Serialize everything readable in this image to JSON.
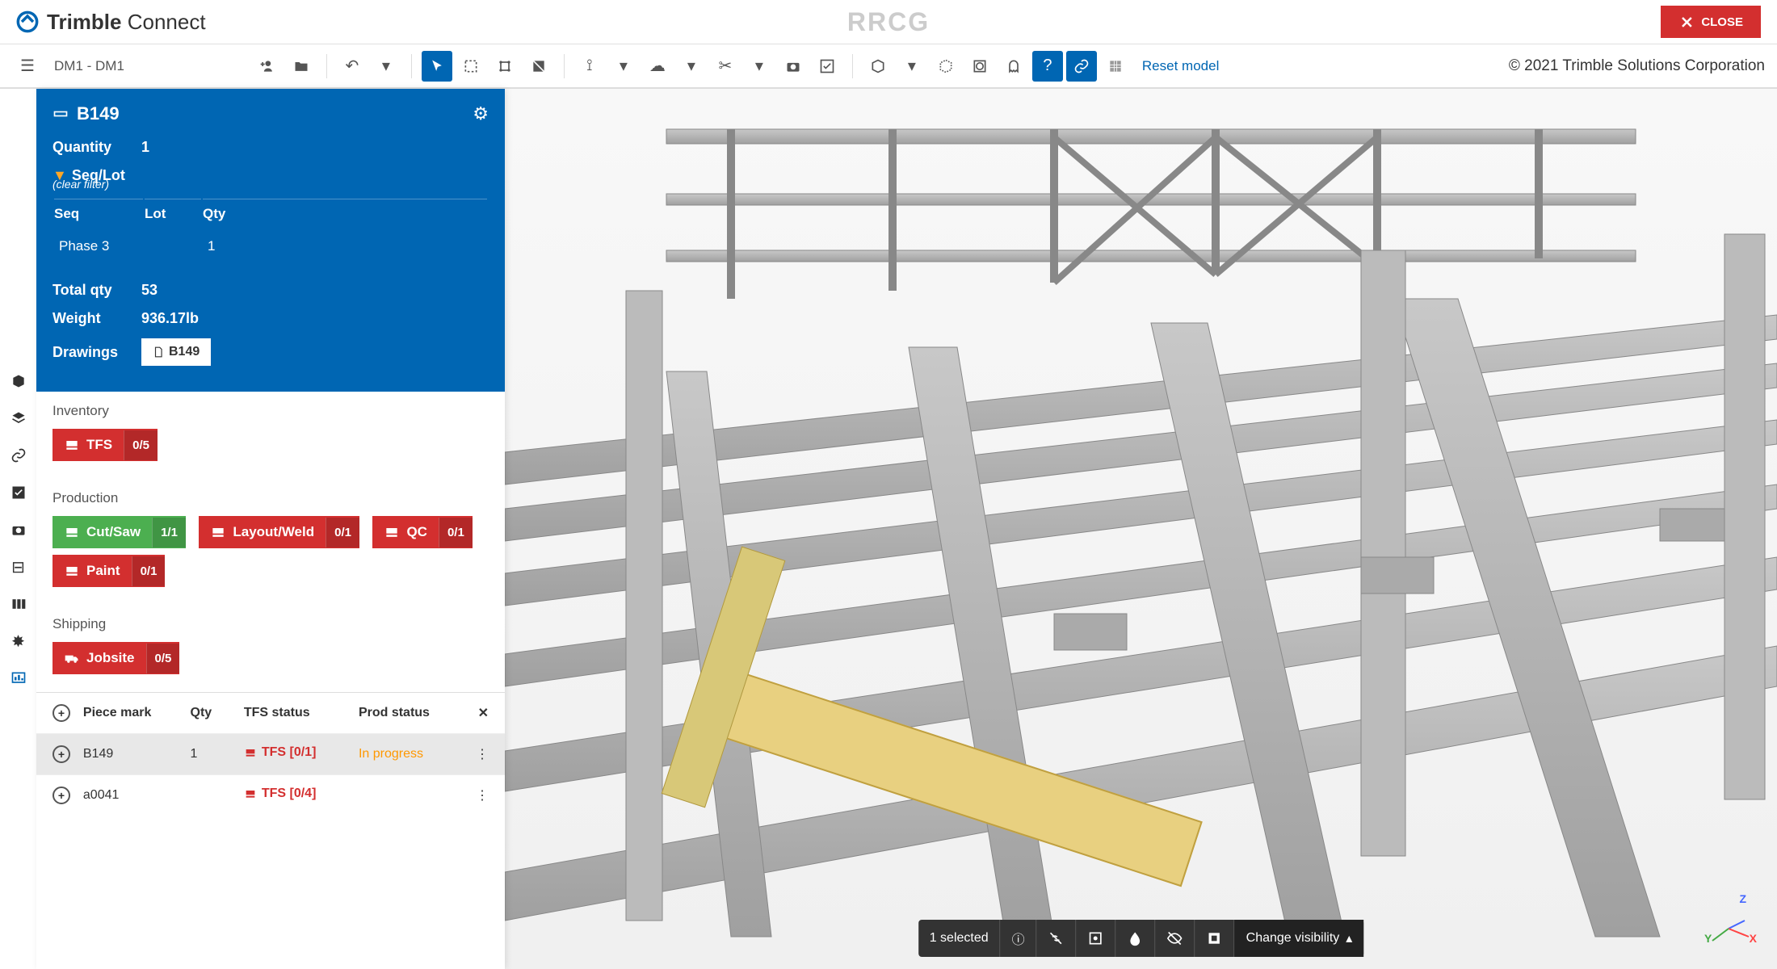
{
  "header": {
    "logo_text_bold": "Trimble",
    "logo_text_light": "Connect",
    "watermark": "RRCG",
    "close_label": "CLOSE"
  },
  "toolbar": {
    "breadcrumb": "DM1 - DM1",
    "reset_label": "Reset model",
    "copyright": "© 2021 Trimble Solutions Corporation"
  },
  "panel": {
    "title": "B149",
    "quantity_label": "Quantity",
    "quantity_value": "1",
    "seqlot_label": "Seq/Lot",
    "clear_filter": "(clear filter)",
    "col_seq": "Seq",
    "col_lot": "Lot",
    "col_qty": "Qty",
    "seq_row": {
      "seq": "Phase 3",
      "lot": "",
      "qty": "1"
    },
    "total_qty_label": "Total qty",
    "total_qty_value": "53",
    "weight_label": "Weight",
    "weight_value": "936.17lb",
    "drawings_label": "Drawings",
    "drawings_btn": "B149"
  },
  "sections": {
    "inventory": {
      "title": "Inventory",
      "chips": [
        {
          "label": "TFS",
          "count": "0/5",
          "color": "red"
        }
      ]
    },
    "production": {
      "title": "Production",
      "chips": [
        {
          "label": "Cut/Saw",
          "count": "1/1",
          "color": "green"
        },
        {
          "label": "Layout/Weld",
          "count": "0/1",
          "color": "red"
        },
        {
          "label": "QC",
          "count": "0/1",
          "color": "red"
        },
        {
          "label": "Paint",
          "count": "0/1",
          "color": "red"
        }
      ]
    },
    "shipping": {
      "title": "Shipping",
      "chips": [
        {
          "label": "Jobsite",
          "count": "0/5",
          "color": "red"
        }
      ]
    }
  },
  "table": {
    "col_piece": "Piece mark",
    "col_qty": "Qty",
    "col_tfs": "TFS status",
    "col_prod": "Prod status",
    "rows": [
      {
        "piece": "B149",
        "qty": "1",
        "tfs": "TFS [0/1]",
        "prod": "In progress"
      },
      {
        "piece": "a0041",
        "qty": "",
        "tfs": "TFS [0/4]",
        "prod": ""
      }
    ]
  },
  "bottombar": {
    "selected": "1 selected",
    "change_vis": "Change visibility"
  },
  "axis": {
    "x": "X",
    "y": "Y",
    "z": "Z"
  }
}
